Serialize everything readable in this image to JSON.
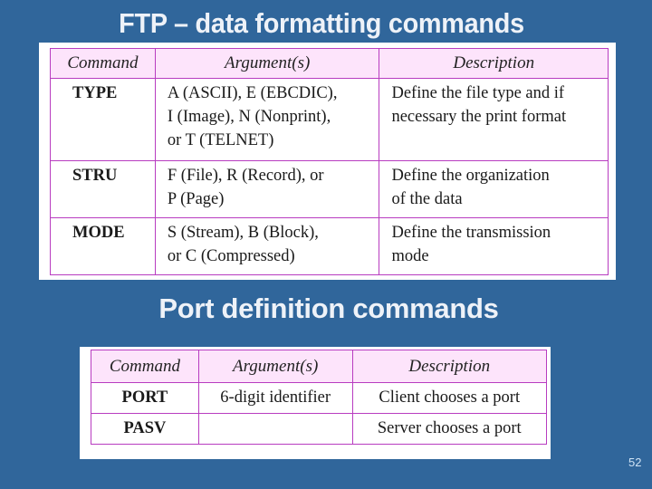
{
  "slide": {
    "title": "FTP – data formatting commands",
    "subtitle": "Port definition commands",
    "page_number": "52"
  },
  "colors": {
    "background": "#30669b",
    "table_border": "#b83cc0",
    "table_header_bg": "#fde4fb",
    "title_text": "#eef2f8"
  },
  "formatting_table": {
    "headers": [
      "Command",
      "Argument(s)",
      "Description"
    ],
    "rows": [
      {
        "command": "TYPE",
        "arguments": [
          "A (ASCII), E (EBCDIC),",
          "I (Image), N (Nonprint),",
          "or T (TELNET)"
        ],
        "description": [
          "Define the file type and if",
          "necessary the print format"
        ]
      },
      {
        "command": "STRU",
        "arguments": [
          "F (File), R (Record), or",
          "P (Page)"
        ],
        "description": [
          "Define the organization",
          "of the data"
        ]
      },
      {
        "command": "MODE",
        "arguments": [
          "S (Stream), B (Block),",
          "or C (Compressed)"
        ],
        "description": [
          "Define the transmission",
          "mode"
        ]
      }
    ]
  },
  "port_table": {
    "headers": [
      "Command",
      "Argument(s)",
      "Description"
    ],
    "rows": [
      {
        "command": "PORT",
        "arguments": "6-digit identifier",
        "description": "Client chooses a port"
      },
      {
        "command": "PASV",
        "arguments": "",
        "description": "Server chooses a port"
      }
    ]
  }
}
